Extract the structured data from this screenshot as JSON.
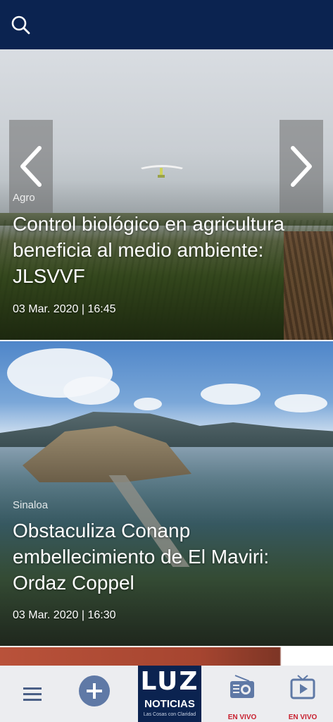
{
  "topbar": {
    "search_icon": "search-icon",
    "bg": "#0b2350"
  },
  "articles": [
    {
      "category": "Agro",
      "title": "Control biológico en agricultura beneficia al medio ambiente: JLSVVF",
      "date": "03 Mar. 2020 | 16:45"
    },
    {
      "category": "Sinaloa",
      "title": "Obstaculiza Conanp embellecimiento de El Maviri: Ordaz Coppel",
      "date": "03 Mar. 2020 | 16:30"
    }
  ],
  "carousel": {
    "prev_icon": "chevron-left-icon",
    "next_icon": "chevron-right-icon"
  },
  "bottom_nav": {
    "menu_icon": "hamburger-menu-icon",
    "add_icon": "plus-icon",
    "logo": {
      "main": "LUZ",
      "sub": "NOTICIAS",
      "tagline": "Las Cosas con Claridad"
    },
    "radio_label": "EN VIVO",
    "tv_label": "EN VIVO",
    "accent": "#c8202f"
  }
}
